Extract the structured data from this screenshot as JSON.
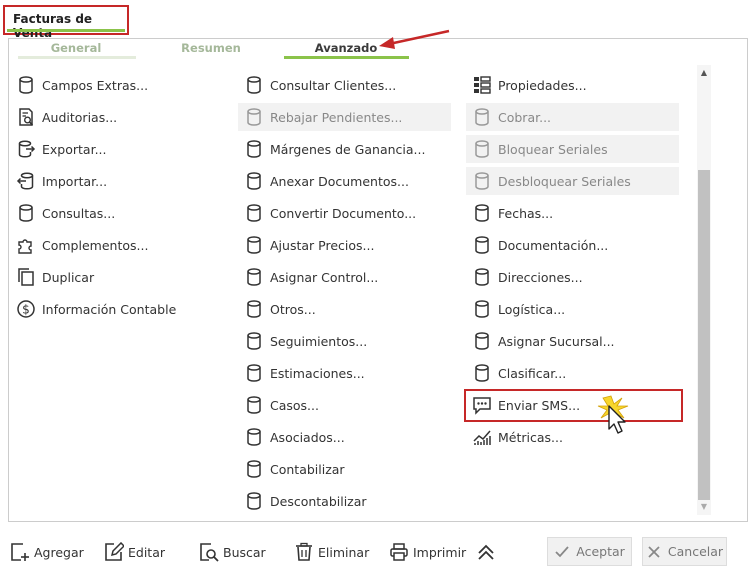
{
  "window": {
    "title": "Facturas de Venta"
  },
  "tabs": [
    {
      "label": "General"
    },
    {
      "label": "Resumen"
    },
    {
      "label": "Avanzado"
    }
  ],
  "col1": [
    {
      "label": "Campos Extras...",
      "icon": "database-icon"
    },
    {
      "label": "Auditorias...",
      "icon": "audit-icon"
    },
    {
      "label": "Exportar...",
      "icon": "export-icon"
    },
    {
      "label": "Importar...",
      "icon": "import-icon"
    },
    {
      "label": "Consultas...",
      "icon": "database-icon"
    },
    {
      "label": "Complementos...",
      "icon": "puzzle-icon"
    },
    {
      "label": "Duplicar",
      "icon": "duplicate-icon"
    },
    {
      "label": "Información Contable",
      "icon": "dollar-icon"
    }
  ],
  "col2": [
    {
      "label": "Consultar Clientes...",
      "icon": "database-icon"
    },
    {
      "label": "Rebajar Pendientes...",
      "icon": "database-icon"
    },
    {
      "label": "Márgenes de Ganancia...",
      "icon": "database-icon"
    },
    {
      "label": "Anexar Documentos...",
      "icon": "database-icon"
    },
    {
      "label": "Convertir Documento...",
      "icon": "database-icon"
    },
    {
      "label": "Ajustar Precios...",
      "icon": "database-icon"
    },
    {
      "label": "Asignar Control...",
      "icon": "database-icon"
    },
    {
      "label": "Otros...",
      "icon": "database-icon"
    },
    {
      "label": "Seguimientos...",
      "icon": "database-icon"
    },
    {
      "label": "Estimaciones...",
      "icon": "database-icon"
    },
    {
      "label": "Casos...",
      "icon": "database-icon"
    },
    {
      "label": "Asociados...",
      "icon": "database-icon"
    },
    {
      "label": "Contabilizar",
      "icon": "database-icon"
    },
    {
      "label": "Descontabilizar",
      "icon": "database-icon"
    }
  ],
  "col3": [
    {
      "label": "Propiedades...",
      "icon": "properties-icon"
    },
    {
      "label": "Cobrar...",
      "icon": "database-icon"
    },
    {
      "label": "Bloquear Seriales",
      "icon": "database-icon"
    },
    {
      "label": "Desbloquear Seriales",
      "icon": "database-icon"
    },
    {
      "label": "Fechas...",
      "icon": "database-icon"
    },
    {
      "label": "Documentación...",
      "icon": "database-icon"
    },
    {
      "label": "Direcciones...",
      "icon": "database-icon"
    },
    {
      "label": "Logística...",
      "icon": "database-icon"
    },
    {
      "label": "Asignar Sucursal...",
      "icon": "database-icon"
    },
    {
      "label": "Clasificar...",
      "icon": "database-icon"
    },
    {
      "label": "Enviar SMS...",
      "icon": "sms-icon"
    },
    {
      "label": "Métricas...",
      "icon": "metrics-icon"
    }
  ],
  "toolbar": {
    "add": "Agregar",
    "edit": "Editar",
    "search": "Buscar",
    "delete": "Eliminar",
    "print": "Imprimir",
    "accept": "Aceptar",
    "cancel": "Cancelar"
  },
  "colors": {
    "accent": "#8bc34a",
    "highlight": "#c62828"
  }
}
